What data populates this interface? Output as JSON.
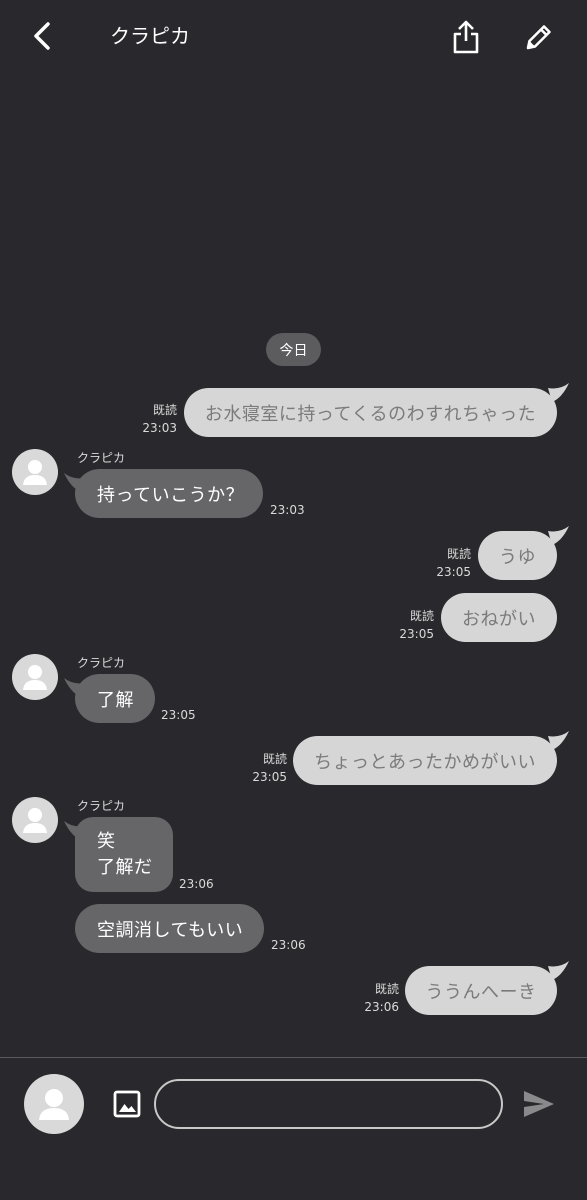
{
  "header": {
    "title": "クラピカ",
    "back_icon": "chevron-left-icon",
    "share_icon": "share-icon",
    "edit_icon": "pencil-icon"
  },
  "date_chip": "今日",
  "messages": [
    {
      "side": "sent",
      "text": "お水寝室に持ってくるのわすれちゃった",
      "read": "既読",
      "time": "23:03"
    },
    {
      "side": "recv",
      "sender": "クラピカ",
      "text": "持っていこうか？",
      "time": "23:03"
    },
    {
      "side": "sent",
      "text": "うゆ",
      "read": "既読",
      "time": "23:05"
    },
    {
      "side": "sent",
      "text": "おねがい",
      "read": "既読",
      "time": "23:05"
    },
    {
      "side": "recv",
      "sender": "クラピカ",
      "text": "了解",
      "time": "23:05"
    },
    {
      "side": "sent",
      "text": "ちょっとあったかめがいい",
      "read": "既読",
      "time": "23:05"
    },
    {
      "side": "recv",
      "sender": "クラピカ",
      "lines": [
        "笑",
        "了解だ"
      ],
      "time": "23:06"
    },
    {
      "side": "recv",
      "text": "空調消してもいい",
      "time": "23:06"
    },
    {
      "side": "sent",
      "text": "ううんへーき",
      "read": "既読",
      "time": "23:06"
    }
  ],
  "composer": {
    "placeholder": "",
    "image_icon": "image-icon",
    "send_icon": "send-icon",
    "avatar_icon": "avatar-icon"
  },
  "colors": {
    "background": "#29282c",
    "sent_bubble": "#d6d6d6",
    "received_bubble": "#666568",
    "date_chip": "#5c5b5e"
  }
}
